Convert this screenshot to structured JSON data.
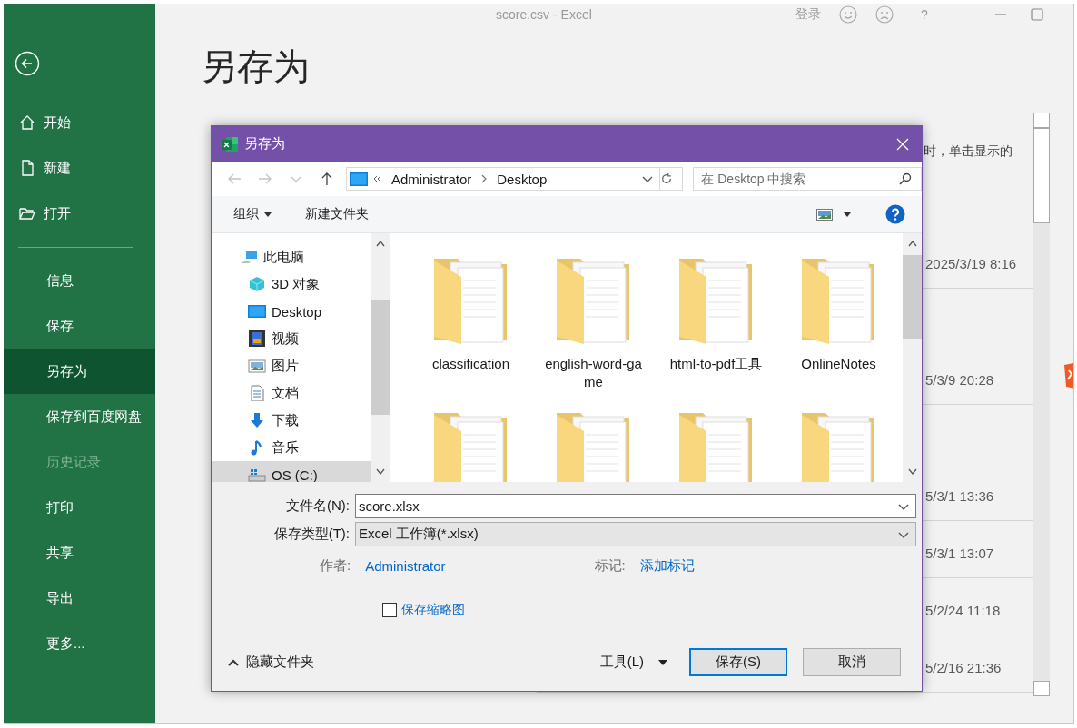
{
  "title_bar": {
    "title": "score.csv  -  Excel",
    "sign_in": "登录",
    "help": "?"
  },
  "sidebar": {
    "items": [
      {
        "label": "开始",
        "kind": "home",
        "selected": false,
        "disabled": false
      },
      {
        "label": "新建",
        "kind": "new",
        "selected": false,
        "disabled": false
      },
      {
        "label": "打开",
        "kind": "open",
        "selected": false,
        "disabled": false
      },
      {
        "kind": "divider"
      },
      {
        "label": "信息",
        "kind": "text",
        "selected": false,
        "disabled": false
      },
      {
        "label": "保存",
        "kind": "text",
        "selected": false,
        "disabled": false
      },
      {
        "label": "另存为",
        "kind": "text",
        "selected": true,
        "disabled": false
      },
      {
        "label": "保存到百度网盘",
        "kind": "text",
        "selected": false,
        "disabled": false
      },
      {
        "label": "历史记录",
        "kind": "text",
        "selected": false,
        "disabled": true
      },
      {
        "label": "打印",
        "kind": "text",
        "selected": false,
        "disabled": false
      },
      {
        "label": "共享",
        "kind": "text",
        "selected": false,
        "disabled": false
      },
      {
        "label": "导出",
        "kind": "text",
        "selected": false,
        "disabled": false
      },
      {
        "label": "更多...",
        "kind": "text",
        "selected": false,
        "disabled": false
      }
    ]
  },
  "page_title": "另存为",
  "background": {
    "hint_text": "时，单击显示的",
    "recent_times": [
      "2025/3/19 8:16",
      "5/3/9 20:28",
      "5/3/1 13:36",
      "5/3/1 13:07",
      "5/2/24 11:18",
      "5/2/16 21:36"
    ]
  },
  "dialog": {
    "title": "另存为",
    "address": {
      "segments": [
        "Administrator",
        "Desktop"
      ]
    },
    "search": {
      "placeholder": "在 Desktop 中搜索"
    },
    "toolbar": {
      "organize": "组织",
      "new_folder": "新建文件夹"
    },
    "nav": [
      {
        "label": "此电脑",
        "kind": "pc",
        "selected": false,
        "children": [
          {
            "label": "3D 对象",
            "kind": "cube",
            "selected": false
          },
          {
            "label": "Desktop",
            "kind": "desktop",
            "selected": false
          },
          {
            "label": "视频",
            "kind": "video",
            "selected": false
          },
          {
            "label": "图片",
            "kind": "picture",
            "selected": false
          },
          {
            "label": "文档",
            "kind": "doc",
            "selected": false
          },
          {
            "label": "下载",
            "kind": "download",
            "selected": false
          },
          {
            "label": "音乐",
            "kind": "music",
            "selected": false
          },
          {
            "label": "OS (C:)",
            "kind": "drive",
            "selected": true
          }
        ]
      }
    ],
    "files": [
      {
        "name": "classification",
        "kind": "folder"
      },
      {
        "name": "english-word-game",
        "kind": "folder"
      },
      {
        "name": "html-to-pdf工具",
        "kind": "folder"
      },
      {
        "name": "OnlineNotes",
        "kind": "folder"
      },
      {
        "kind": "folder"
      },
      {
        "kind": "folder"
      },
      {
        "kind": "folder"
      },
      {
        "kind": "folder"
      }
    ],
    "filename": {
      "label": "文件名(N):",
      "value": "score.xlsx"
    },
    "filetype": {
      "label": "保存类型(T):",
      "value": "Excel 工作簿(*.xlsx)"
    },
    "author": {
      "label": "作者:",
      "value": "Administrator"
    },
    "tags": {
      "label": "标记:",
      "value": "添加标记"
    },
    "thumbnail": {
      "label": "保存缩略图",
      "checked": false
    },
    "hide_folders": "隐藏文件夹",
    "tools": "工具(L)",
    "save": "保存(S)",
    "cancel": "取消"
  }
}
